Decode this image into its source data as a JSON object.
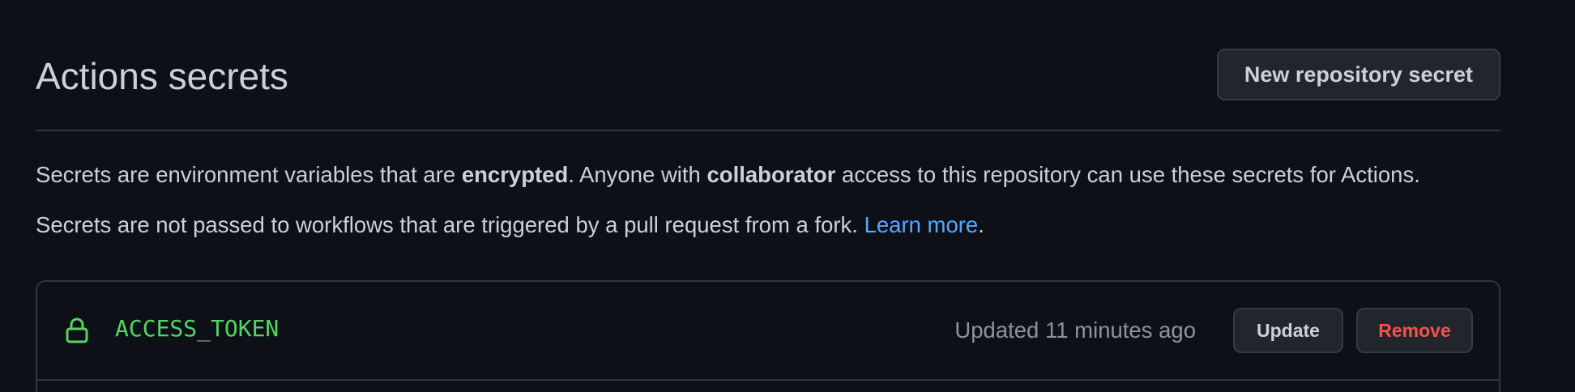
{
  "header": {
    "title": "Actions secrets",
    "new_secret_label": "New repository secret"
  },
  "description": {
    "line1": {
      "part1": "Secrets are environment variables that are ",
      "bold1": "encrypted",
      "part2": ". Anyone with ",
      "bold2": "collaborator",
      "part3": " access to this repository can use these secrets for Actions."
    },
    "line2": {
      "text": "Secrets are not passed to workflows that are triggered by a pull request from a fork. ",
      "link": "Learn more",
      "end": "."
    }
  },
  "secrets": [
    {
      "icon": "lock-icon",
      "name": "ACCESS_TOKEN",
      "updated": "Updated 11 minutes ago",
      "update_label": "Update",
      "remove_label": "Remove"
    }
  ],
  "colors": {
    "background": "#0d1117",
    "text": "#c9d1d9",
    "muted": "#8b949e",
    "link": "#58a6ff",
    "secret_name": "#56d364",
    "danger": "#f85149",
    "border": "#30363d"
  }
}
